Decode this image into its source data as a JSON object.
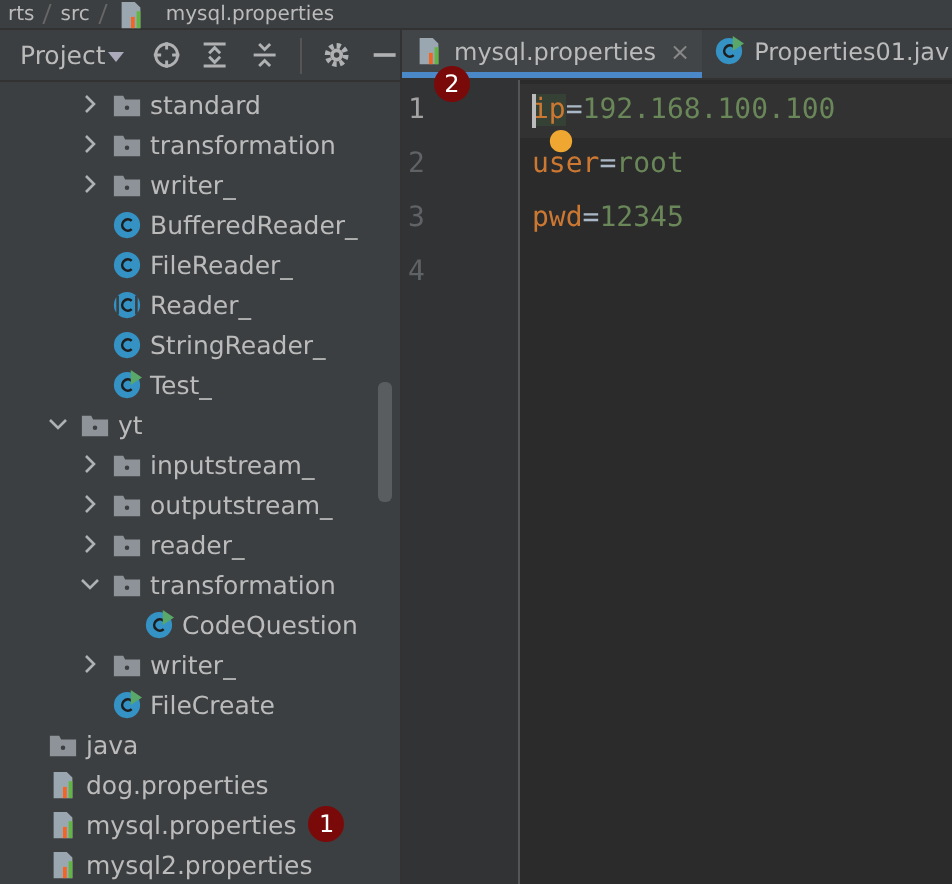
{
  "breadcrumb": [
    "rts",
    "src",
    "mysql.properties"
  ],
  "project_panel": {
    "title": "Project",
    "toolbar": [
      {
        "kind": "locate"
      },
      {
        "kind": "expand"
      },
      {
        "kind": "collapse"
      },
      {
        "kind": "settings"
      },
      {
        "kind": "hide"
      }
    ]
  },
  "tree": [
    {
      "children": [
        {
          "children": [
            {
              "label": "standard",
              "kind": "folder",
              "expanded": false
            },
            {
              "label": "transformation",
              "kind": "folder",
              "expanded": false
            },
            {
              "label": "writer_",
              "kind": "folder",
              "expanded": false
            },
            {
              "label": "BufferedReader_",
              "kind": "class"
            },
            {
              "label": "FileReader_",
              "kind": "class"
            },
            {
              "label": "Reader_",
              "kind": "abstract"
            },
            {
              "label": "StringReader_",
              "kind": "class"
            },
            {
              "label": "Test_",
              "kind": "runnable"
            }
          ]
        },
        {
          "label": "yt",
          "kind": "folder",
          "expanded": true,
          "children": [
            {
              "label": "inputstream_",
              "kind": "folder",
              "expanded": false
            },
            {
              "label": "outputstream_",
              "kind": "folder",
              "expanded": false
            },
            {
              "label": "reader_",
              "kind": "folder",
              "expanded": false
            },
            {
              "label": "transformation",
              "kind": "folder",
              "expanded": true,
              "children": [
                {
                  "label": "CodeQuestion",
                  "kind": "runnable"
                }
              ]
            },
            {
              "label": "writer_",
              "kind": "folder",
              "expanded": false
            },
            {
              "label": "FileCreate",
              "kind": "runnable"
            }
          ]
        }
      ]
    },
    {
      "label": "java",
      "kind": "folder"
    },
    {
      "label": "dog.properties",
      "kind": "properties"
    },
    {
      "label": "mysql.properties",
      "kind": "properties",
      "badge": "1"
    },
    {
      "label": "mysql2.properties",
      "kind": "properties"
    }
  ],
  "tabs": [
    {
      "label": "mysql.properties",
      "kind": "properties",
      "selected": true,
      "close": "×",
      "badge": "2"
    },
    {
      "label": "Properties01.jav",
      "kind": "runnable",
      "selected": false
    }
  ],
  "editor": {
    "lines": [
      {
        "number": "1",
        "key": "ip",
        "sep": "=",
        "value": "192.168.100.100",
        "current": true
      },
      {
        "number": "2",
        "key": "user",
        "sep": "=",
        "value": "root",
        "current": false,
        "bulb": true
      },
      {
        "number": "3",
        "key": "pwd",
        "sep": "=",
        "value": "12345",
        "current": false
      },
      {
        "number": "4",
        "current": false
      }
    ]
  }
}
